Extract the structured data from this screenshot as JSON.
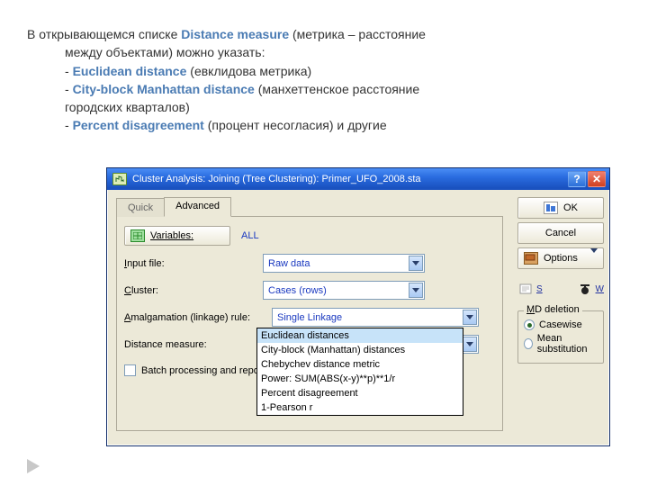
{
  "desc": {
    "line1a": "В открывающемся списке ",
    "term1": "Distance measure",
    "line1b": " (метрика – расстояние",
    "line2": "между объектами) можно указать:",
    "bullet1a": "- ",
    "term2": "Euclidean distance",
    "bullet1b": " (евклидова метрика)",
    "bullet2a": "- ",
    "term3": "City-block Manhattan distance",
    "bullet2b": " (манхеттенское расстояние",
    "line5": "городских кварталов)",
    "bullet3a": "- ",
    "term4": "Percent  disagreement",
    "bullet3b": " (процент несогласия) и другие"
  },
  "dialog": {
    "title": "Cluster Analysis: Joining (Tree Clustering): Primer_UFO_2008.sta",
    "help": "?",
    "close": "✕",
    "tabs": {
      "quick": "Quick",
      "advanced": "Advanced"
    },
    "variables_btn": "Variables:",
    "variables_val": "ALL",
    "labels": {
      "input_file": "Input file:",
      "cluster": "Cluster:",
      "amalg": "Amalgamation (linkage) rule:",
      "distance": "Distance measure:",
      "d_short": "D",
      "batch": "Batch processing and repo"
    },
    "values": {
      "input_file": "Raw data",
      "cluster": "Cases (rows)",
      "amalg": "Single Linkage",
      "distance": "Euclidean distances"
    },
    "dropdown_options": [
      "Euclidean distances",
      "City-block (Manhattan) distances",
      "Chebychev distance metric",
      "Power: SUM(ABS(x-y)**p)**1/r",
      "Percent disagreement",
      "1-Pearson r"
    ],
    "right": {
      "ok": "OK",
      "cancel": "Cancel",
      "options": "Options",
      "s_label": "S",
      "w_label": "W",
      "md_legend": "MD deletion",
      "radio_casewise": "Casewise",
      "radio_mean": "Mean substitution"
    }
  }
}
